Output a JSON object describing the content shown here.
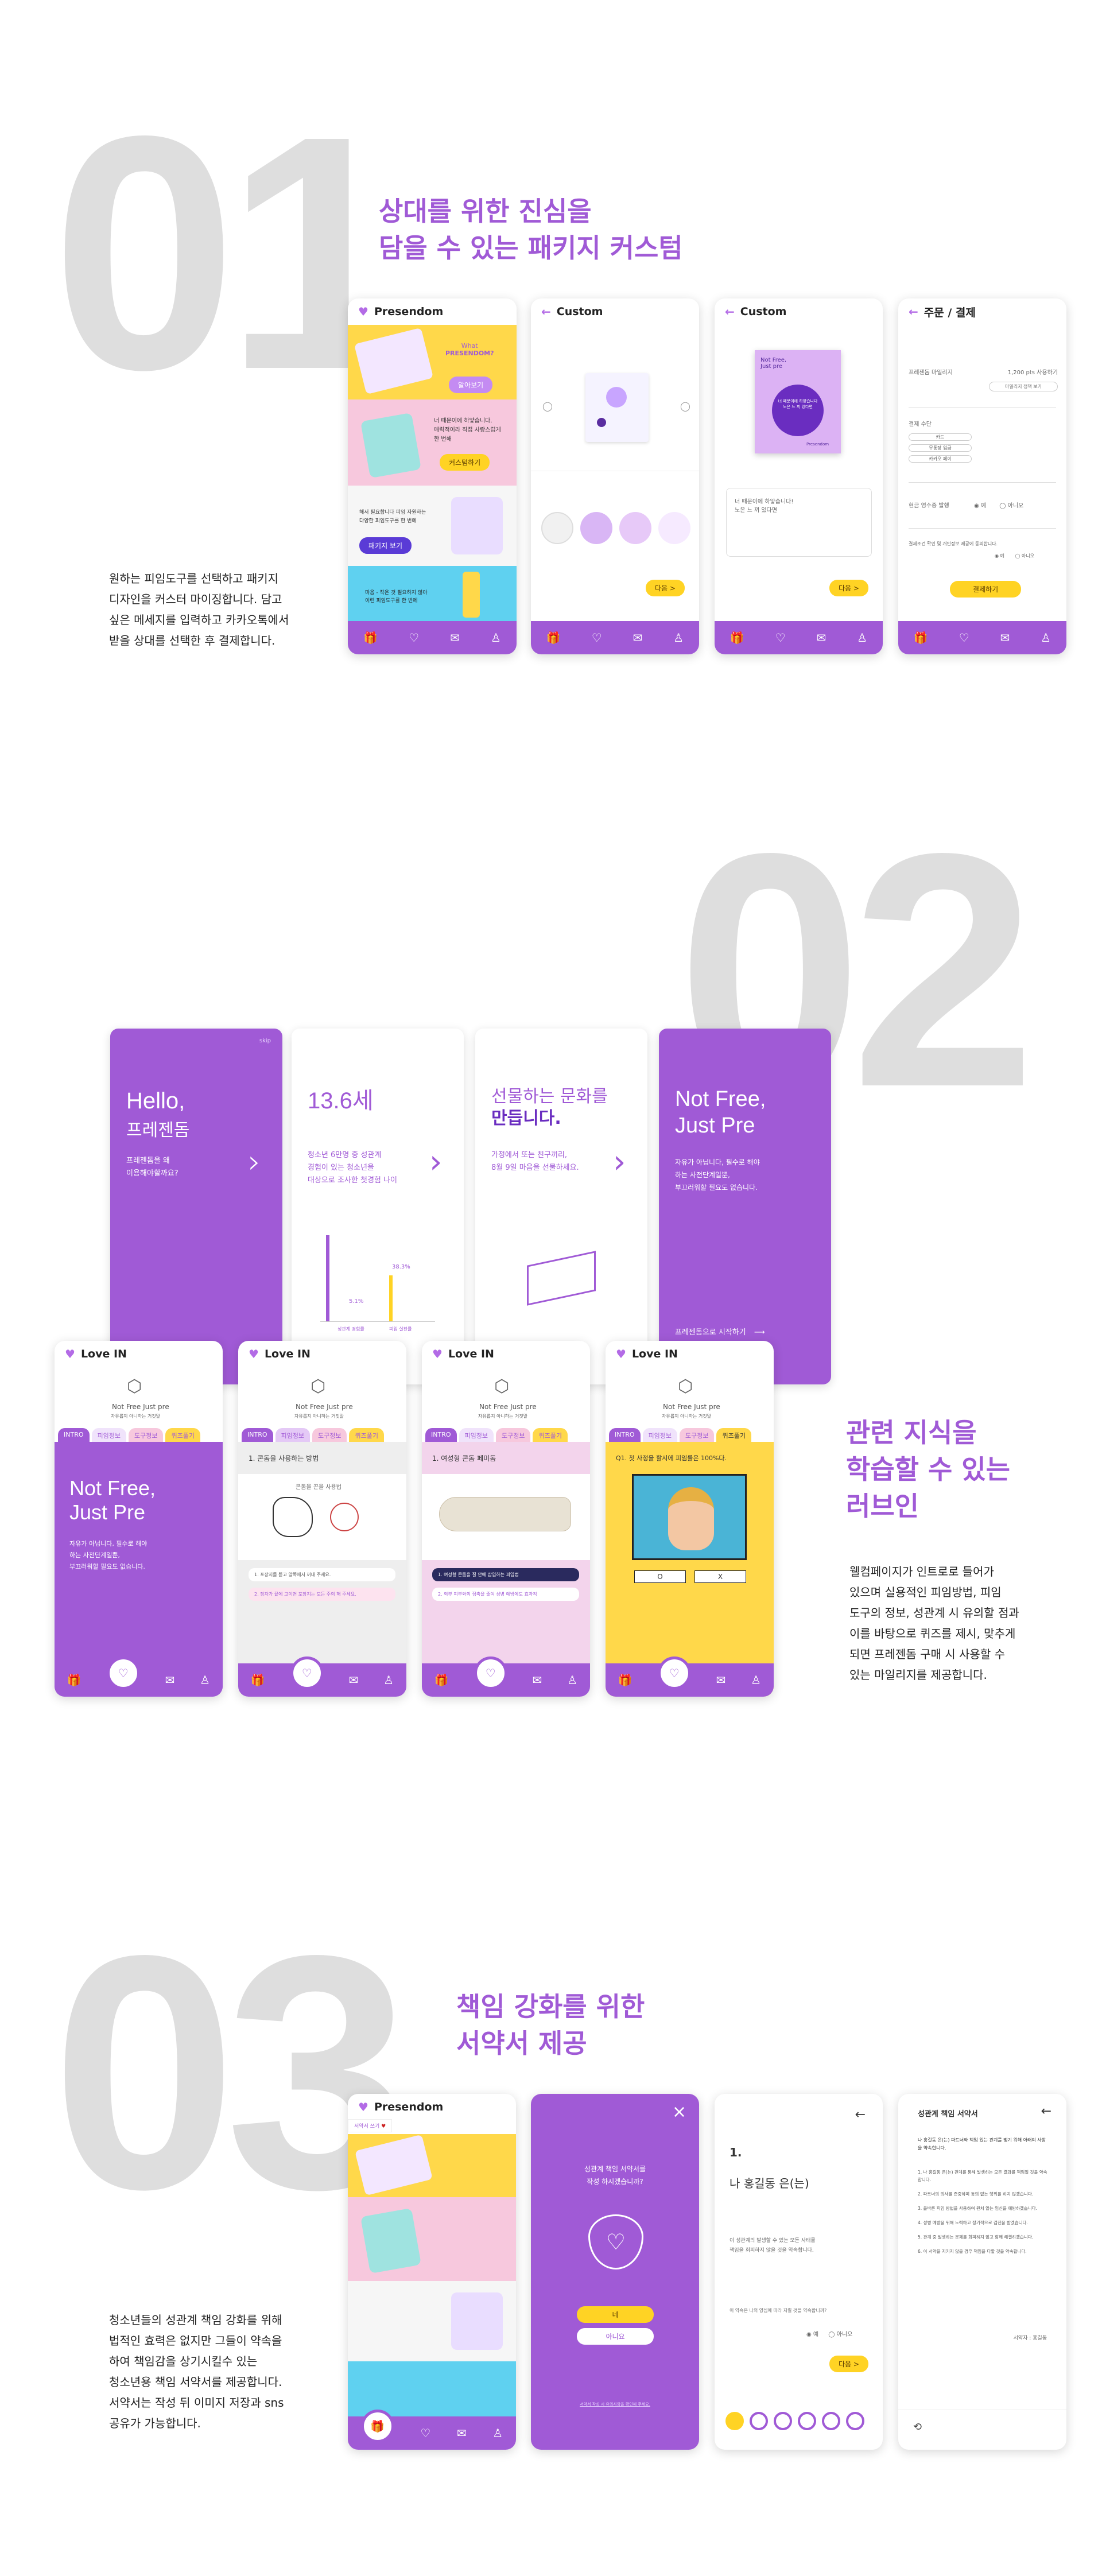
{
  "section1": {
    "number": "01",
    "title_line1": "상대를 위한 진심을",
    "title_line2": "담을 수 있는 패키지 커스텀",
    "desc": [
      "원하는 피임도구를 선택하고 패키지",
      "디자인을 커스터 마이징합니다. 담고",
      "싶은 메세지를 입력하고 카카오톡에서",
      "받을 상대를 선택한 후 결제합니다."
    ],
    "screen_home": {
      "title": "Presendom",
      "banner_line1": "What",
      "banner_line2": "PRESENDOM?",
      "banner_btn": "알아보기",
      "msg_line1": "너 때문이에 하얗습니다.",
      "msg_line2": "매력적이라 직접 사랑스럽게",
      "msg_line3": "한 번해",
      "msg_btn": "커스텀하기",
      "love_line1": "해서 필요합니다 피임 자원하는",
      "love_line2": "다양한 피임도구를 한 번에",
      "love_btn": "패키지 보기",
      "news_line1": "마음 - 작은 것 필요하지 않아",
      "news_line2": "이런 피임도구를 한 번에"
    },
    "screen_custom1": {
      "title": "Custom",
      "next_btn": "다음 >"
    },
    "screen_custom2": {
      "title": "Custom",
      "box_line1": "Not Free,",
      "box_line2": "Just pre",
      "box_msg": "너 때문이에 하얗습니다 노은 느 끼 있다면",
      "brand": "Presendom",
      "input_line1": "너 때문이에 하얗습니다!",
      "input_line2": "노은 느 끼 있다면",
      "next_btn": "다음 >"
    },
    "screen_order": {
      "title": "주문 / 결제",
      "row1_label": "프레젠돔 마일리지",
      "row1_value": "1,200 pts 사용하기",
      "row1_btn": "마일리지 정책 보기",
      "pay_label": "결제 수단",
      "pay_opt1": "카드",
      "pay_opt2": "무통장 입금",
      "pay_opt3": "카카오 페이",
      "ship_label": "현금 영수증 발행",
      "ship_opt1": "예",
      "ship_opt2": "아니오",
      "agree_text": "결제조건 확인 및 개인정보 제공에 동의합니다.",
      "agree_opt1": "예",
      "agree_opt2": "아니오",
      "pay_btn": "결제하기"
    }
  },
  "section2": {
    "number": "02",
    "title_line1": "관련 지식을",
    "title_line2": "학습할 수 있는",
    "title_line3": "러브인",
    "desc": [
      "웰컴페이지가 인트로로 들어가",
      "있으며 실용적인 피임방법, 피임",
      "도구의 정보, 성관계 시 유의할 점과",
      "이를 바탕으로 퀴즈를 제시, 맞추게",
      "되면 프레젠돔 구매 시 사용할 수",
      "있는 마일리지를 제공합니다."
    ],
    "intro1": {
      "skip": "skip",
      "line1": "Hello,",
      "line2": "프레젠돔",
      "sub1": "프레젠돔을 왜",
      "sub2": "이용해야할까요?"
    },
    "intro2": {
      "big": "13.6세",
      "sub1": "청소년 6만명 중 성관계",
      "sub2": "경험이 있는 청소년을",
      "sub3": "대상으로 조사한 첫경험 나이",
      "bar1_value": "5.1%",
      "bar2_value": "38.3%",
      "bar1_label": "성관계 경험률",
      "bar2_label": "피임 실천률"
    },
    "intro3": {
      "line1": "선물하는 문화를",
      "line2": "만듭니다.",
      "sub1": "가정에서 또는 친구끼리,",
      "sub2": "8월 9일 마음을 선물하세요."
    },
    "intro4": {
      "line1": "Not Free,",
      "line2": "Just Pre",
      "sub1": "자유가 아닙니다, 필수로 해야",
      "sub2": "하는 사전단계일뿐,",
      "sub3": "부끄러워할 필요도 없습니다.",
      "start": "프레젠돔으로 시작하기"
    },
    "lovein_title": "Love IN",
    "lovein_tagline": "Not Free Just pre",
    "lovein_tagline_sub": "자유롭지 아니하는 거짓말",
    "tabs": [
      "INTRO",
      "피임정보",
      "도구정보",
      "퀴즈풀기"
    ],
    "screen_intro": {
      "line1": "Not Free,",
      "line2": "Just Pre",
      "sub1": "자유가 아닙니다, 필수로 해야",
      "sub2": "하는 사전단계일뿐,",
      "sub3": "부끄러워할 필요도 없습니다."
    },
    "screen_method": {
      "heading": "1. 콘돔을 사용하는 방법",
      "img_caption": "콘돔을 꼰을 사용법",
      "step1": "1. 포장지를 뜯고 앞쪽에서 꺼내 주세요.",
      "step2": "2. 정자가 끝에 고이면 포장지는 모든 주의 해 주세요."
    },
    "screen_tool": {
      "heading": "1. 여성형 콘돔 페미돔",
      "note1": "1. 여성형 콘돔을 질 안에 삽입하는 피임법",
      "note2": "2. 외부 피부와의 접촉을 줄여 성병 예방에도 효과적"
    },
    "screen_quiz": {
      "question": "Q1. 첫 사정을 할시에 피임률은 100%다.",
      "opt_o": "O",
      "opt_x": "X"
    }
  },
  "section3": {
    "number": "03",
    "title_line1": "책임 강화를 위한",
    "title_line2": "서약서 제공",
    "desc": [
      "청소년들의 성관계 책임 강화를 위해",
      "법적인 효력은 없지만 그들이 약속을",
      "하여 책임감을 상기시킬수 있는",
      "청소년용 책임 서약서를 제공합니다.",
      "서약서는 작성 뒤 이미지 저장과 sns",
      "공유가 가능합니다."
    ],
    "screen_home": {
      "title": "Presendom",
      "tab": "서약서 쓰기"
    },
    "screen_modal": {
      "close": "×",
      "q1": "성관계 책임 서약서를",
      "q2": "작성 하시겠습니까?",
      "yes": "네",
      "no": "아니요",
      "link": "서약서 작성 시 유의사항을 확인해 주세요."
    },
    "screen_step": {
      "num": "1.",
      "name": "나 홍길동 은(는)",
      "body1": "이 성관계의 발생할 수 있는 모든 사태를",
      "body2": "책임을 회피하지 않을 것을 약속합니다.",
      "q": "이 약속은 나의 양심에 따라 지킬 것을 약속합니까?",
      "opt1": "예",
      "opt2": "아니오",
      "next": "다음 >"
    },
    "screen_contract": {
      "title": "성관계 책임 서약서",
      "intro": "나 홍길동 은(는) 파트너와 책임 있는 관계를 맺기 위해 아래의 사항을 약속합니다.",
      "items": [
        "1. 나 홍길동 은(는) 관계를 통해 발생하는 모든 결과를 책임질 것을 약속합니다.",
        "2. 파트너의 의사를 존중하며 동의 없는 행위를 하지 않겠습니다.",
        "3. 올바른 피임 방법을 사용하여 원치 않는 임신을 예방하겠습니다.",
        "4. 성병 예방을 위해 노력하고 정기적으로 검진을 받겠습니다.",
        "5. 관계 중 발생하는 문제를 회피하지 않고 함께 해결하겠습니다.",
        "6. 이 서약을 지키지 않을 경우 책임을 다할 것을 약속합니다."
      ],
      "signer": "서약자 : 홍길동"
    }
  }
}
